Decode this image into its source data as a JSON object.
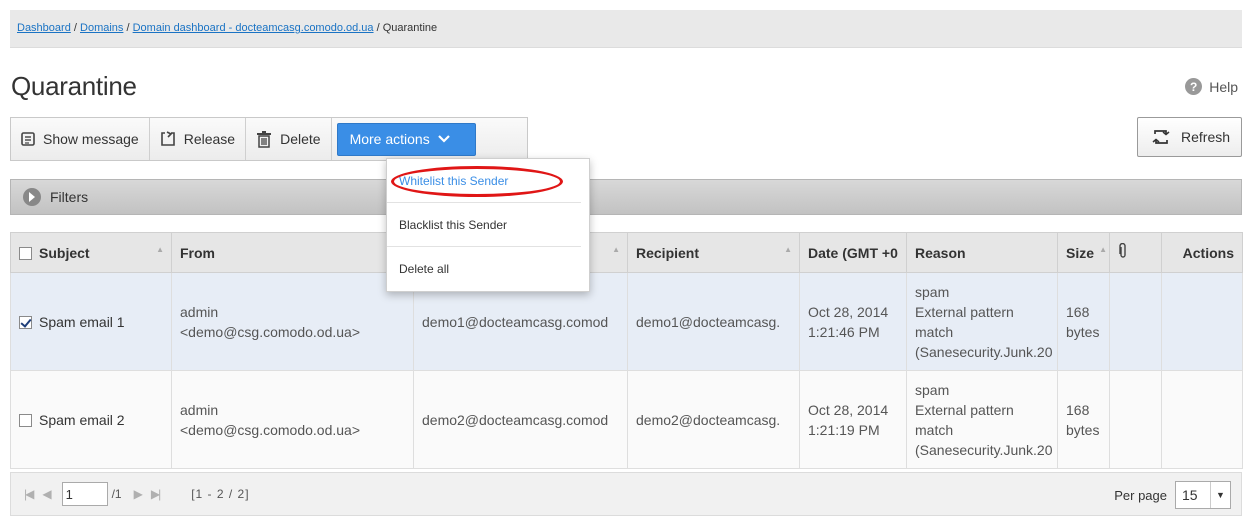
{
  "breadcrumb": {
    "items": [
      "Dashboard",
      "Domains",
      "Domain dashboard - docteamcasg.comodo.od.ua"
    ],
    "current": "Quarantine",
    "separator": "/"
  },
  "page": {
    "title": "Quarantine",
    "help_label": "Help"
  },
  "toolbar": {
    "show_message": "Show message",
    "release": "Release",
    "delete": "Delete",
    "more_actions": "More actions",
    "refresh": "Refresh"
  },
  "filters": {
    "label": "Filters"
  },
  "more_actions_menu": {
    "items": [
      "Whitelist this Sender",
      "Blacklist this Sender",
      "Delete all"
    ],
    "highlight_color": "#e01616"
  },
  "table": {
    "columns": [
      "Subject",
      "From",
      "",
      "Recipient",
      "Date (GMT +0",
      "Reason",
      "Size",
      "",
      "Actions"
    ],
    "rows": [
      {
        "checked": true,
        "subject": "Spam email 1",
        "from_name": "admin",
        "from_email": "<demo@csg.comodo.od.ua>",
        "to": "demo1@docteamcasg.comod",
        "recipient": "demo1@docteamcasg.",
        "date": "Oct 28, 2014",
        "time": "1:21:46 PM",
        "reason": [
          "spam",
          "External pattern",
          "match",
          "(Sanesecurity.Junk.20"
        ],
        "size": "168",
        "size_unit": "bytes"
      },
      {
        "checked": false,
        "subject": "Spam email 2",
        "from_name": "admin",
        "from_email": "<demo@csg.comodo.od.ua>",
        "to": "demo2@docteamcasg.comod",
        "recipient": "demo2@docteamcasg.",
        "date": "Oct 28, 2014",
        "time": "1:21:19 PM",
        "reason": [
          "spam",
          "External pattern",
          "match",
          "(Sanesecurity.Junk.20"
        ],
        "size": "168",
        "size_unit": "bytes"
      }
    ]
  },
  "pager": {
    "page": "1",
    "of": "/1",
    "range": "[1 - 2 / 2]",
    "per_page_label": "Per page",
    "per_page_value": "15"
  },
  "colors": {
    "accent": "#3a8ee6",
    "link": "#1a73c4",
    "selected_row": "#e7edf6"
  }
}
